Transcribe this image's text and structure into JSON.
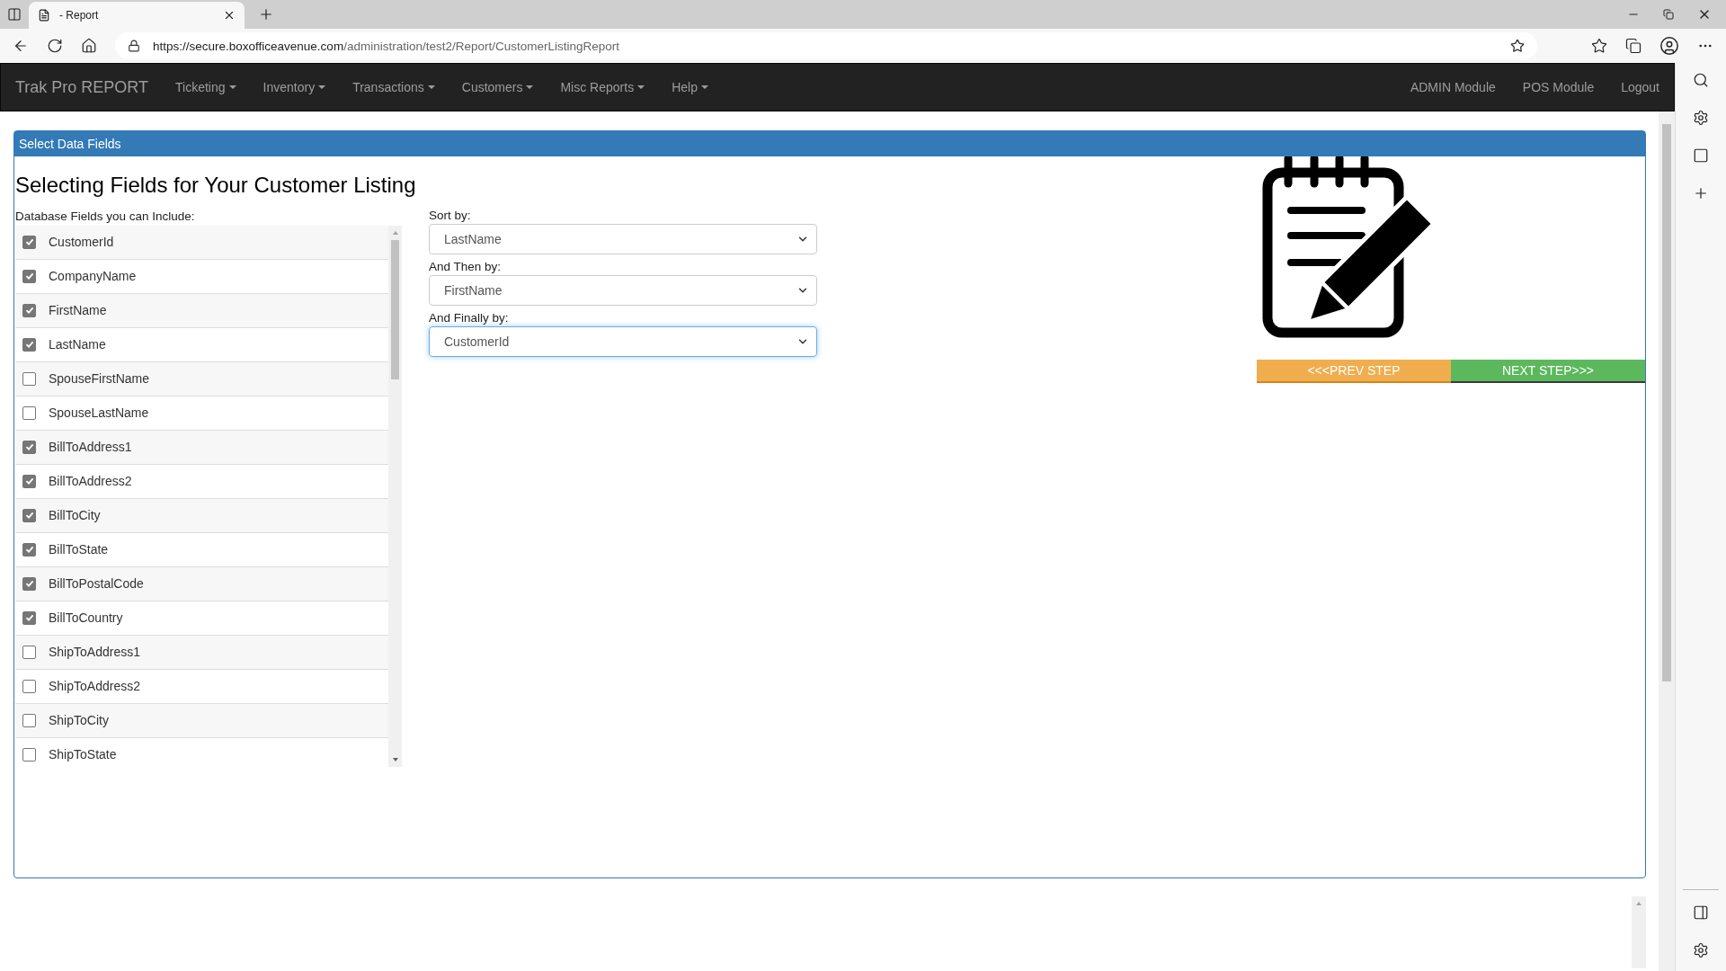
{
  "browser": {
    "tab_title": "- Report",
    "url_host": "https://secure.boxofficeavenue.com",
    "url_path": "/administration/test2/Report/CustomerListingReport"
  },
  "navbar": {
    "brand": "Trak Pro REPORT",
    "menus": [
      {
        "label": "Ticketing"
      },
      {
        "label": "Inventory"
      },
      {
        "label": "Transactions"
      },
      {
        "label": "Customers"
      },
      {
        "label": "Misc Reports"
      },
      {
        "label": "Help"
      }
    ],
    "right_links": [
      "ADMIN Module",
      "POS Module",
      "Logout"
    ]
  },
  "panel": {
    "header": "Select Data Fields",
    "title": "Selecting Fields for Your Customer Listing",
    "fields_label": "Database Fields you can Include:",
    "fields": [
      {
        "name": "CustomerId",
        "checked": true
      },
      {
        "name": "CompanyName",
        "checked": true
      },
      {
        "name": "FirstName",
        "checked": true
      },
      {
        "name": "LastName",
        "checked": true
      },
      {
        "name": "SpouseFirstName",
        "checked": false
      },
      {
        "name": "SpouseLastName",
        "checked": false
      },
      {
        "name": "BillToAddress1",
        "checked": true
      },
      {
        "name": "BillToAddress2",
        "checked": true
      },
      {
        "name": "BillToCity",
        "checked": true
      },
      {
        "name": "BillToState",
        "checked": true
      },
      {
        "name": "BillToPostalCode",
        "checked": true
      },
      {
        "name": "BillToCountry",
        "checked": true
      },
      {
        "name": "ShipToAddress1",
        "checked": false
      },
      {
        "name": "ShipToAddress2",
        "checked": false
      },
      {
        "name": "ShipToCity",
        "checked": false
      },
      {
        "name": "ShipToState",
        "checked": false
      }
    ],
    "sorts": [
      {
        "label": "Sort by:",
        "value": "LastName",
        "focused": false
      },
      {
        "label": "And Then by:",
        "value": "FirstName",
        "focused": false
      },
      {
        "label": "And Finally by:",
        "value": "CustomerId",
        "focused": true
      }
    ],
    "buttons": [
      {
        "label": "<<<PREV STEP",
        "kind": "prev"
      },
      {
        "label": "NEXT STEP>>>",
        "kind": "next"
      }
    ]
  }
}
